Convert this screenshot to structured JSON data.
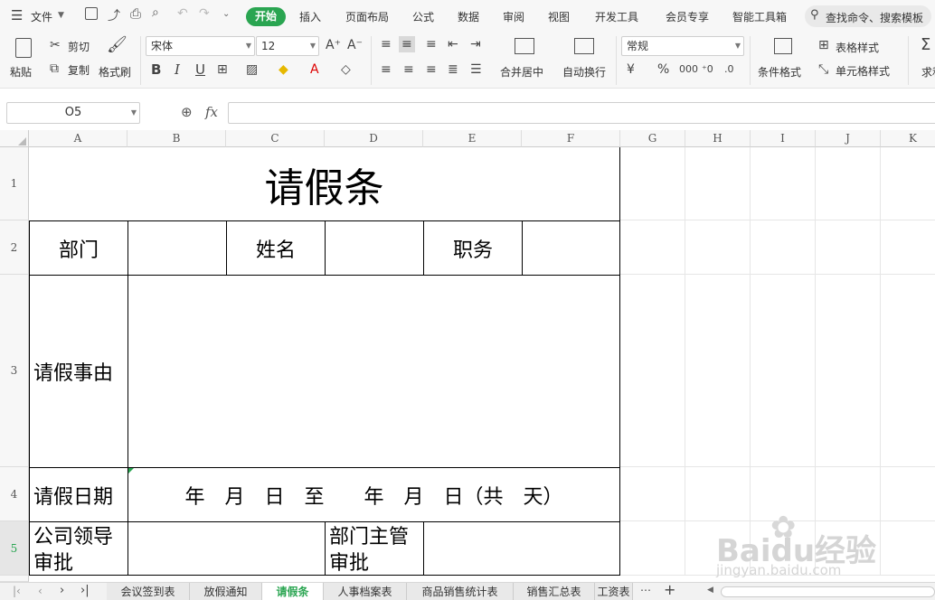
{
  "menu": {
    "file": "文件",
    "tabs": [
      "开始",
      "插入",
      "页面布局",
      "公式",
      "数据",
      "审阅",
      "视图",
      "开发工具",
      "会员专享",
      "智能工具箱"
    ],
    "active_tab": "开始",
    "search_placeholder": "查找命令、搜索模板"
  },
  "ribbon": {
    "paste": "粘贴",
    "cut": "剪切",
    "copy": "复制",
    "format_painter": "格式刷",
    "font_name": "宋体",
    "font_size": "12",
    "bold": "B",
    "italic": "I",
    "underline": "U",
    "merge_center": "合并居中",
    "wrap_text": "自动换行",
    "number_format": "常规",
    "conditional_format": "条件格式",
    "table_style": "表格样式",
    "cell_style": "单元格样式",
    "sum": "求和"
  },
  "formula_bar": {
    "name_box": "O5",
    "fx": "fx"
  },
  "columns": [
    "A",
    "B",
    "C",
    "D",
    "E",
    "F",
    "G",
    "H",
    "I",
    "J",
    "K"
  ],
  "rows": [
    "1",
    "2",
    "3",
    "4",
    "5"
  ],
  "form": {
    "title": "请假条",
    "dept_label": "部门",
    "name_label": "姓名",
    "position_label": "职务",
    "reason_label": "请假事由",
    "date_label": "请假日期",
    "date_text": "年　月　日　至　　年　月　日（共　天）",
    "leader_label": "公司领导审批",
    "supervisor_label": "部门主管审批"
  },
  "sheet_tabs": [
    "会议签到表",
    "放假通知",
    "请假条",
    "人事档案表",
    "商品销售统计表",
    "销售汇总表",
    "工资表"
  ],
  "active_sheet": "请假条",
  "watermark": {
    "logo": "Baidu经验",
    "url": "jingyan.baidu.com"
  },
  "colors": {
    "accent": "#2aa551",
    "header_bg": "#f7f7f7"
  }
}
